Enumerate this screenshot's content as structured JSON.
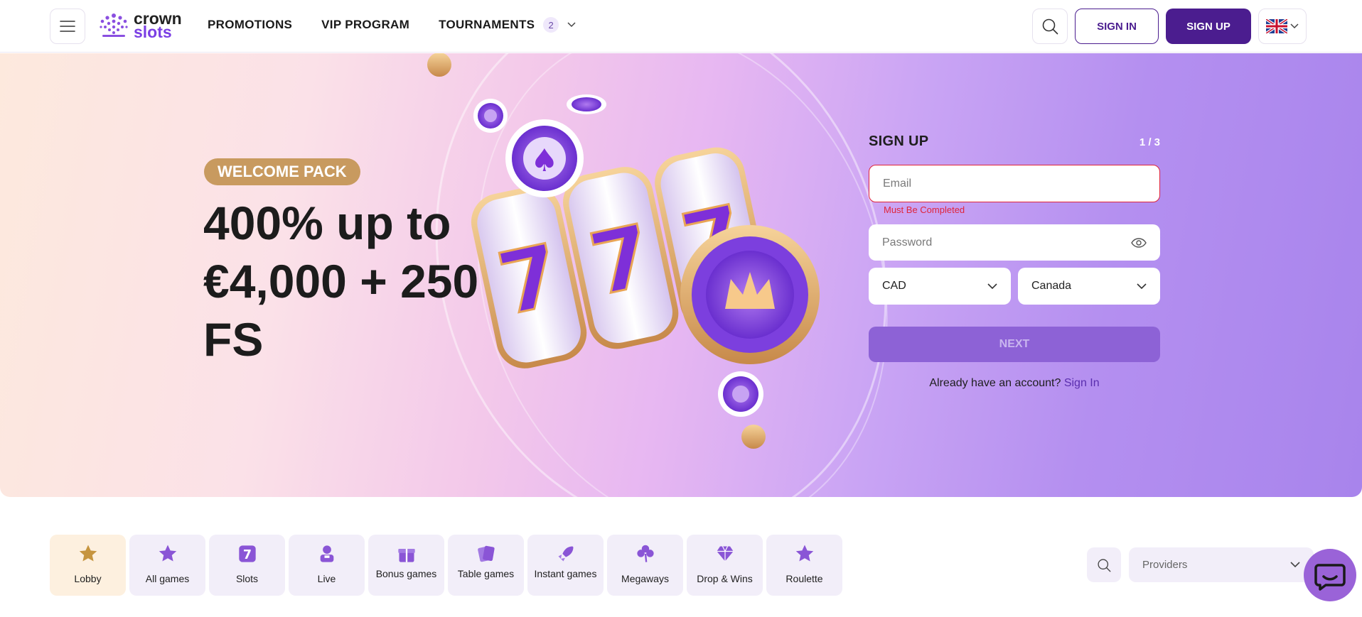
{
  "brand": {
    "line1": "crown",
    "line2": "slots"
  },
  "nav": {
    "promotions": "PROMOTIONS",
    "vip": "VIP PROGRAM",
    "tournaments": "TOURNAMENTS",
    "tournaments_count": "2"
  },
  "header": {
    "sign_in": "SIGN IN",
    "sign_up": "SIGN UP",
    "language_icon": "uk-flag-icon"
  },
  "hero": {
    "badge": "WELCOME PACK",
    "title": "400% up to €4,000 + 250 FS"
  },
  "signup_form": {
    "title": "SIGN UP",
    "step": "1 / 3",
    "email_placeholder": "Email",
    "email_error": "Must Be Completed",
    "password_placeholder": "Password",
    "currency": "CAD",
    "country": "Canada",
    "next": "NEXT",
    "have_account": "Already have an account?",
    "sign_in_link": "Sign In"
  },
  "categories": [
    {
      "label": "Lobby",
      "icon": "star-icon",
      "active": true
    },
    {
      "label": "All games",
      "icon": "star-icon"
    },
    {
      "label": "Slots",
      "icon": "seven-icon"
    },
    {
      "label": "Live",
      "icon": "dealer-icon"
    },
    {
      "label": "Bonus games",
      "icon": "gift-icon"
    },
    {
      "label": "Table games",
      "icon": "cards-icon"
    },
    {
      "label": "Instant games",
      "icon": "rocket-icon"
    },
    {
      "label": "Megaways",
      "icon": "clover-icon"
    },
    {
      "label": "Drop & Wins",
      "icon": "diamond-icon"
    },
    {
      "label": "Roulette",
      "icon": "star-icon"
    }
  ],
  "providers": {
    "placeholder": "Providers"
  },
  "colors": {
    "primary": "#4b1d8f",
    "accent": "#7b3fe4",
    "error": "#e0243a",
    "badge": "#c89a5f"
  }
}
